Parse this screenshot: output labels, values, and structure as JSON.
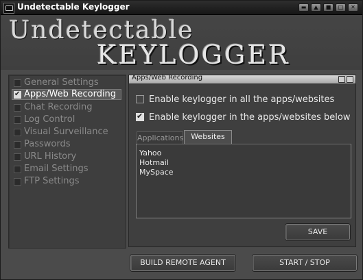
{
  "window": {
    "title": "Undetectable Keylogger",
    "controls": [
      "minimize",
      "restore",
      "minimize-to-tray",
      "maximize",
      "close"
    ]
  },
  "banner": {
    "line1": "Undetectable",
    "line2": "KEYLOGGER"
  },
  "sidebar": {
    "items": [
      {
        "label": "General Settings",
        "checked": false
      },
      {
        "label": "Apps/Web Recording",
        "checked": true
      },
      {
        "label": "Chat Recording",
        "checked": false
      },
      {
        "label": "Log Control",
        "checked": false
      },
      {
        "label": "Visual Surveillance",
        "checked": false
      },
      {
        "label": "Passwords",
        "checked": false
      },
      {
        "label": "URL History",
        "checked": false
      },
      {
        "label": "Email Settings",
        "checked": false
      },
      {
        "label": "FTP Settings",
        "checked": false
      }
    ]
  },
  "panel": {
    "title": "Apps/Web Recording",
    "options": [
      {
        "label": "Enable keylogger in all the apps/websites",
        "checked": false
      },
      {
        "label": "Enable keylogger in the apps/websites below",
        "checked": true
      }
    ],
    "tabs": [
      {
        "label": "Applications",
        "active": false
      },
      {
        "label": "Websites",
        "active": true
      }
    ],
    "websites": [
      "Yahoo",
      "Hotmail",
      "MySpace"
    ],
    "save_label": "SAVE"
  },
  "footer": {
    "build_label": "BUILD REMOTE AGENT",
    "start_label": "START / STOP"
  }
}
